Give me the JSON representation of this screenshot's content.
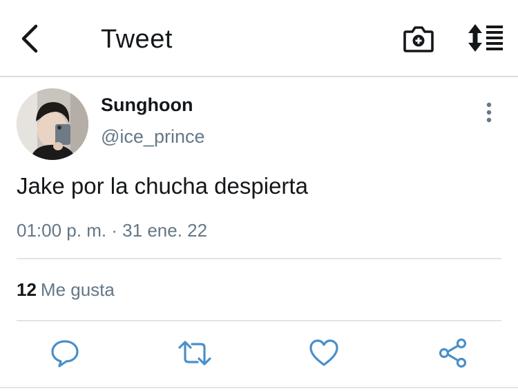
{
  "header": {
    "title": "Tweet",
    "back_icon": "chevron-left-icon",
    "camera_icon": "camera-plus-icon",
    "sort_icon": "sort-list-icon"
  },
  "tweet": {
    "display_name": "Sunghoon",
    "handle": "@ice_prince",
    "text": "Jake por la chucha despierta",
    "timestamp": "01:00 p. m. · 31 ene. 22",
    "likes_count": "12",
    "likes_label": "Me gusta"
  },
  "actions": {
    "reply_icon": "reply-icon",
    "retweet_icon": "retweet-icon",
    "like_icon": "heart-icon",
    "share_icon": "share-icon"
  },
  "colors": {
    "text_primary": "#14171a",
    "text_secondary": "#657786",
    "icon_blue": "#4a8fc9",
    "divider": "#e1e4e7"
  }
}
